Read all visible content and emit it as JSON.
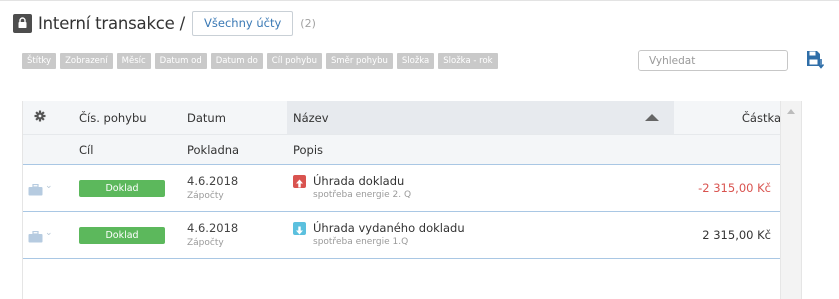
{
  "header": {
    "title": "Interní transakce /",
    "accounts_button": "Všechny účty",
    "count": "(2)"
  },
  "filters": [
    "Štítky",
    "Zobrazení",
    "Měsíc",
    "Datum od",
    "Datum do",
    "Cíl pohybu",
    "Směr pohybu",
    "Složka",
    "Složka - rok"
  ],
  "search": {
    "placeholder": "Vyhledat"
  },
  "table": {
    "columns_row1": {
      "settings": "gear-icon",
      "number": "Čís. pohybu",
      "date": "Datum",
      "name": "Název",
      "amount": "Částka"
    },
    "columns_row2": {
      "target": "Cíl",
      "cashbox": "Pokladna",
      "description": "Popis"
    },
    "rows": [
      {
        "type_label": "Doklad",
        "date": "4.6.2018",
        "cashbox": "Zápočty",
        "direction": "up",
        "name": "Úhrada dokladu",
        "description": "spotřeba energie 2. Q",
        "amount": "-2 315,00 Kč"
      },
      {
        "type_label": "Doklad",
        "date": "4.6.2018",
        "cashbox": "Zápočty",
        "direction": "down",
        "name": "Úhrada vydaného dokladu",
        "description": "spotřeba energie 1.Q",
        "amount": "2 315,00 Kč"
      }
    ]
  },
  "colors": {
    "accent": "#3a79b5",
    "badge_green": "#5cb85c",
    "negative": "#d9534f",
    "incoming": "#5bc0de",
    "save_icon": "#2f6ea8"
  }
}
